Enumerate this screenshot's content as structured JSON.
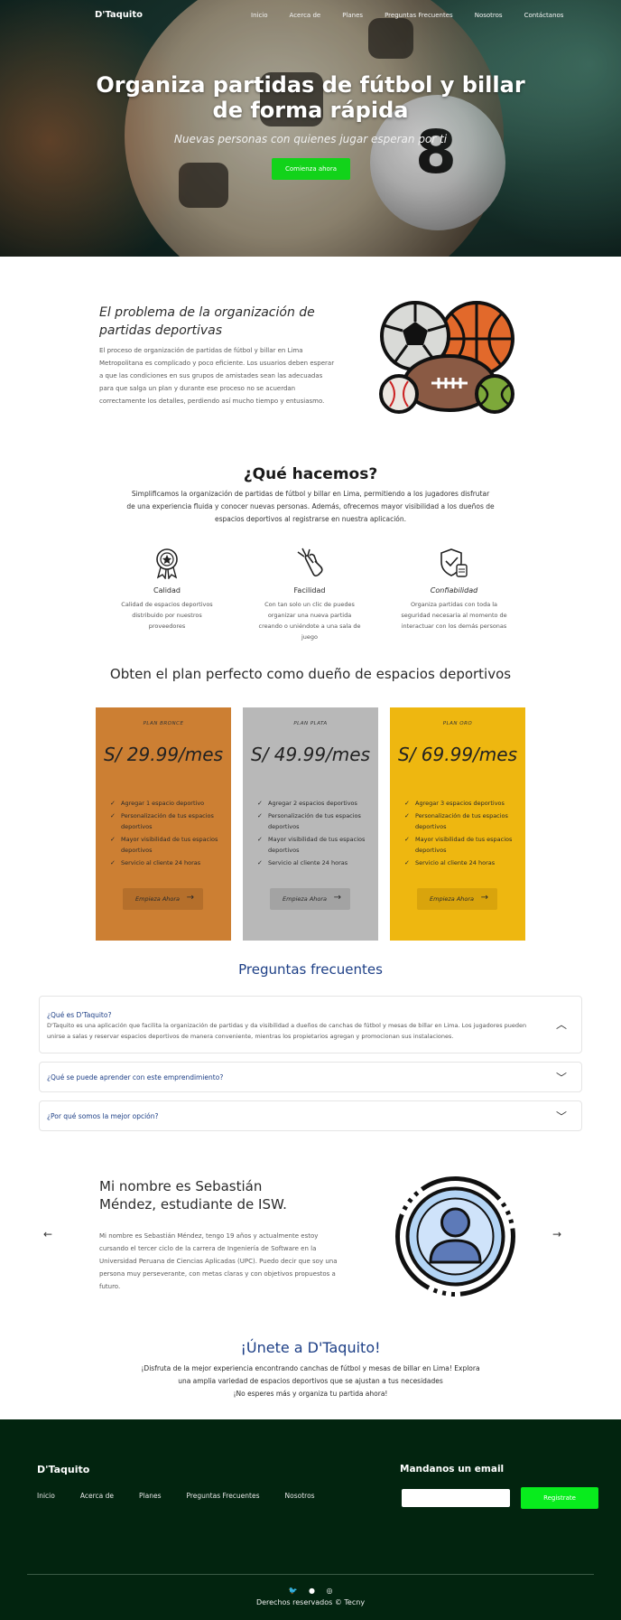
{
  "nav": {
    "brand": "D'Taquito",
    "links": [
      "Inicio",
      "Acerca de",
      "Planes",
      "Preguntas Frecuentes",
      "Nosotros",
      "Contáctanos"
    ]
  },
  "hero": {
    "title": "Organiza partidas de fútbol y billar de forma rápida",
    "subtitle": "Nuevas personas con quienes jugar esperan por ti",
    "cta": "Comienza ahora",
    "ball_number": "8"
  },
  "problem": {
    "title": "El problema de la organización de partidas deportivas",
    "text": "El proceso de organización de partidas de fútbol y billar en Lima Metropolitana es complicado y poco eficiente. Los usuarios deben esperar a que las condiciones en sus grupos de amistades sean las adecuadas para que salga un plan y durante ese proceso no se acuerdan correctamente los detalles, perdiendo así mucho tiempo y entusiasmo."
  },
  "what": {
    "title": "¿Qué hacemos?",
    "text": "Simplificamos la organización de partidas de fútbol y billar en Lima, permitiendo a los jugadores disfrutar de una experiencia fluida y conocer nuevas personas. Además, ofrecemos mayor visibilidad a los dueños de espacios deportivos al registrarse en nuestra aplicación.",
    "features": [
      {
        "icon": "award-icon",
        "title": "Calidad",
        "text": "Calidad de espacios deportivos distribuido por nuestros proveedores"
      },
      {
        "icon": "tap-icon",
        "title": "Facilidad",
        "text": "Con tan solo un clic de puedes organizar una nueva partida creando o uniéndote a una sala de juego"
      },
      {
        "icon": "shield-icon",
        "title": "Confiabilidad",
        "text": "Organiza partidas con toda la seguridad necesaria al momento de interactuar con los demás personas"
      }
    ]
  },
  "plans": {
    "title": "Obten el plan perfecto como dueño de espacios deportivos",
    "items": [
      {
        "name": "PLAN BRONCE",
        "price": "S/ 29.99/mes",
        "color": "#cc7f33",
        "features": [
          "Agregar 1 espacio deportivo",
          "Personalización de tus espacios deportivos",
          "Mayor visibilidad de tus espacios deportivos",
          "Servicio al cliente 24 horas"
        ],
        "button": "Empieza Ahora",
        "button_color": "#b56f2b"
      },
      {
        "name": "PLAN PLATA",
        "price": "S/ 49.99/mes",
        "color": "#b8b8b8",
        "features": [
          "Agregar 2 espacios deportivos",
          "Personalización de tus espacios deportivos",
          "Mayor visibilidad de tus espacios deportivos",
          "Servicio al cliente 24 horas"
        ],
        "button": "Empieza Ahora",
        "button_color": "#a3a3a3"
      },
      {
        "name": "PLAN ORO",
        "price": "S/ 69.99/mes",
        "color": "#eeb710",
        "features": [
          "Agregar 3 espacios deportivos",
          "Personalización de tus espacios deportivos",
          "Mayor visibilidad de tus espacios deportivos",
          "Servicio al cliente 24 horas"
        ],
        "button": "Empieza Ahora",
        "button_color": "#d9a40c"
      }
    ]
  },
  "faq": {
    "title": "Preguntas frecuentes",
    "items": [
      {
        "q": "¿Qué es D'Taquito?",
        "a": "D'Taquito es una aplicación que facilita la organización de partidas y da visibilidad a dueños de canchas de fútbol y mesas de billar en Lima. Los jugadores pueden unirse a salas y reservar espacios deportivos de manera conveniente, mientras los propietarios agregan y promocionan sus instalaciones.",
        "open": true
      },
      {
        "q": "¿Qué se puede aprender con este emprendimiento?",
        "a": "",
        "open": false
      },
      {
        "q": "¿Por qué somos la mejor opción?",
        "a": "",
        "open": false
      }
    ]
  },
  "testimonial": {
    "title": "Mi nombre es Sebastián Méndez, estudiante de ISW.",
    "text": "Mi nombre es Sebastián Méndez, tengo 19 años y actualmente estoy cursando el tercer ciclo de la carrera de Ingeniería de Software en la Universidad Peruana de Ciencias Aplicadas (UPC). Puedo decir que soy una persona muy perseverante, con metas claras y con objetivos propuestos a futuro.",
    "prev": "←",
    "next": "→"
  },
  "join": {
    "title": "¡Únete a D'Taquito!",
    "line1": "¡Disfruta de la mejor experiencia encontrando canchas de fútbol y mesas de billar en Lima! Explora",
    "line2": "una amplia variedad de espacios deportivos que se ajustan a tus necesidades",
    "line3": "¡No esperes más y organiza tu partida ahora!"
  },
  "footer": {
    "brand": "D'Taquito",
    "links": [
      "Inicio",
      "Acerca de",
      "Planes",
      "Preguntas Frecuentes",
      "Nosotros"
    ],
    "email_title": "Mandanos un email",
    "email_placeholder": "",
    "button": "Registrate",
    "copyright": "Derechos reservados © Tecny",
    "social": [
      "twitter-icon",
      "facebook-icon",
      "instagram-icon"
    ]
  },
  "colors": {
    "accent_green": "#12d31a",
    "heading_blue": "#1d3f86",
    "footer_bg": "#02240f"
  }
}
